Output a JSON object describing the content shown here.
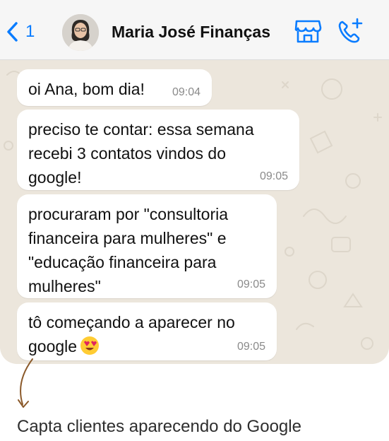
{
  "header": {
    "back_count": "1",
    "contact_name": "Maria José Finanças",
    "icons": [
      "chevron-left-icon",
      "store-icon",
      "phone-add-icon"
    ],
    "accent_color": "#0a7cff"
  },
  "messages": [
    {
      "text": "oi Ana, bom dia!",
      "time": "09:04"
    },
    {
      "text": "preciso te contar: essa semana recebi 3 contatos vindos do google!",
      "time": "09:05"
    },
    {
      "text": "procuraram por \"consultoria financeira para mulheres\" e \"educação financeira para mulheres\"",
      "time": "09:05"
    },
    {
      "text": "tô começando a aparecer no google",
      "emoji": "heart-eyes-emoji",
      "time": "09:05"
    }
  ],
  "caption": "Capta clientes aparecendo do Google",
  "colors": {
    "chat_background": "#ece6dc",
    "bubble": "#ffffff",
    "arrow": "#8b5a2b"
  }
}
